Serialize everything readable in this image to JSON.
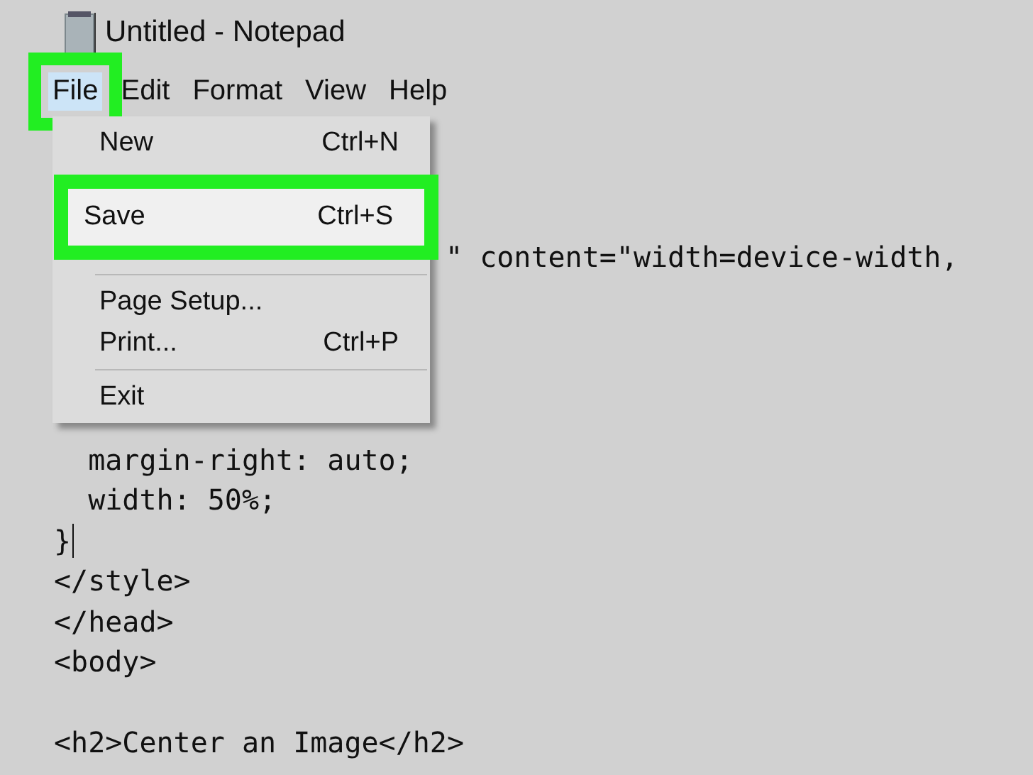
{
  "window": {
    "title": "Untitled - Notepad"
  },
  "menu_bar": [
    {
      "label": "File",
      "selected": true
    },
    {
      "label": "Edit",
      "selected": false
    },
    {
      "label": "Format",
      "selected": false
    },
    {
      "label": "View",
      "selected": false
    },
    {
      "label": "Help",
      "selected": false
    }
  ],
  "file_menu": [
    {
      "kind": "item",
      "label": "New",
      "shortcut": "Ctrl+N",
      "selected": false
    },
    {
      "kind": "item",
      "label": "Save",
      "shortcut": "Ctrl+S",
      "selected": true
    },
    {
      "kind": "separator"
    },
    {
      "kind": "item",
      "label": "Page Setup...",
      "selected": false
    },
    {
      "kind": "item",
      "label": "Print...",
      "shortcut": "Ctrl+P",
      "selected": false
    },
    {
      "kind": "separator"
    },
    {
      "kind": "item",
      "label": "Exit",
      "selected": false
    }
  ],
  "editor": {
    "lines": [
      {
        "kind": "partial",
        "text": "\" content=\"width=device-width,"
      },
      {
        "kind": "line",
        "text": "  margin-right: auto;"
      },
      {
        "kind": "line",
        "text": "  width: 50%;"
      },
      {
        "kind": "caret",
        "text": "}"
      },
      {
        "kind": "line",
        "text": "</style>"
      },
      {
        "kind": "line",
        "text": "</head>"
      },
      {
        "kind": "line",
        "text": "<body>"
      },
      {
        "kind": "blank"
      },
      {
        "kind": "line",
        "text": "<h2>Center an Image</h2>"
      }
    ]
  }
}
